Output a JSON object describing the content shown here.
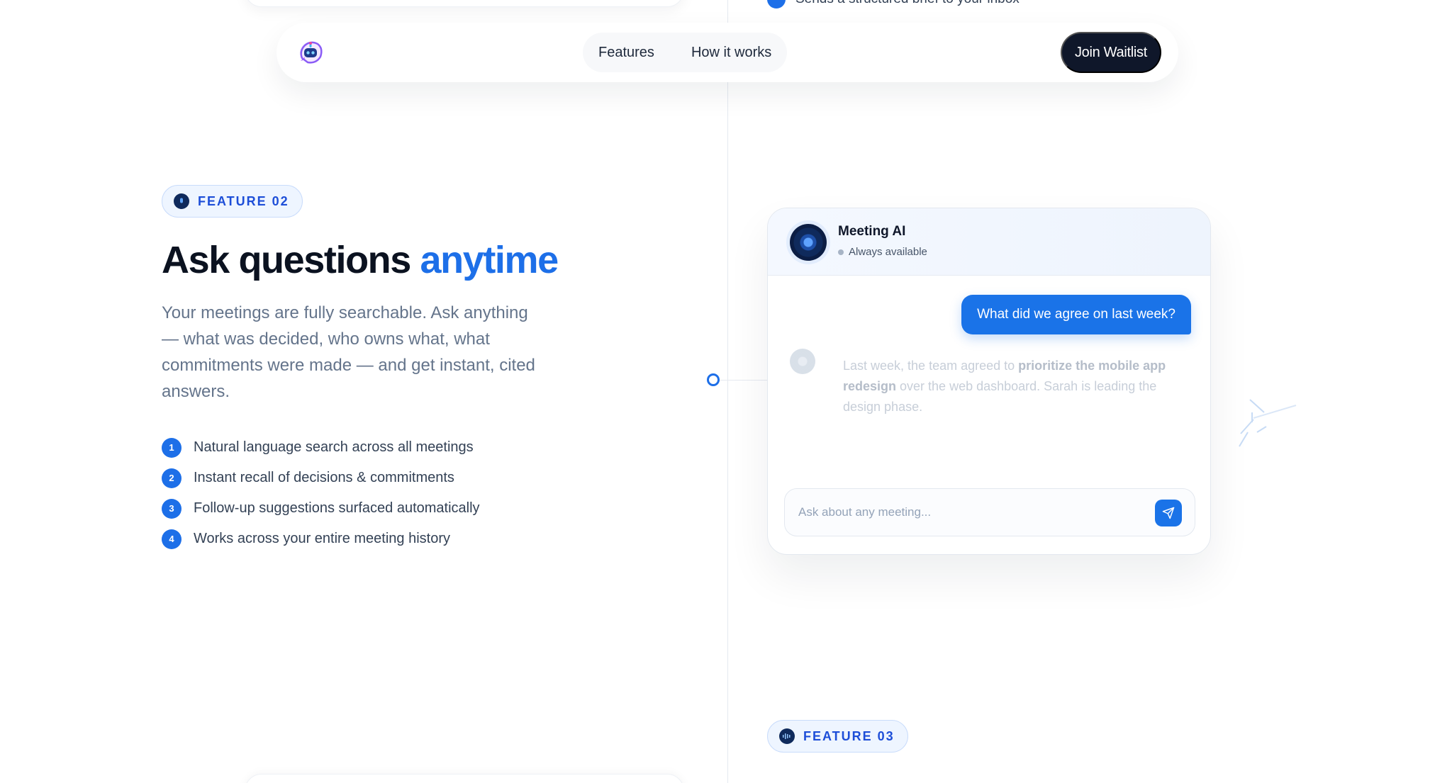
{
  "nav": {
    "logo_icon": "robot-chat-logo-icon",
    "links": [
      "Features",
      "How it works"
    ],
    "cta": "Join Waitlist"
  },
  "top_fragment": {
    "text": "Sends a structured brief to your inbox"
  },
  "feature02": {
    "badge": "FEATURE 02",
    "badge_icon": "microphone-icon",
    "title_main": "Ask questions ",
    "title_accent": "anytime",
    "description": "Your meetings are fully searchable. Ask anything — what was decided, who owns what, what commitments were made — and get instant, cited answers.",
    "bullets": [
      {
        "num": "1",
        "text": "Natural language search across all meetings"
      },
      {
        "num": "2",
        "text": "Instant recall of decisions & commitments"
      },
      {
        "num": "3",
        "text": "Follow-up suggestions surfaced automatically"
      },
      {
        "num": "4",
        "text": "Works across your entire meeting history"
      }
    ]
  },
  "chat": {
    "name": "Meeting AI",
    "status": "Always available",
    "user_message": "What did we agree on last week?",
    "reply_before": "Last week, the team agreed to ",
    "reply_bold1": "prioritize the mobile app redesign",
    "reply_after": " over the web dashboard. Sarah is leading the design phase.",
    "input_placeholder": "Ask about any meeting...",
    "send_icon": "send-icon"
  },
  "feature03": {
    "badge": "FEATURE 03",
    "badge_icon": "audio-waveform-icon"
  },
  "colors": {
    "accent": "#1d6fe8",
    "dark": "#0f172a",
    "muted": "#64748b"
  }
}
